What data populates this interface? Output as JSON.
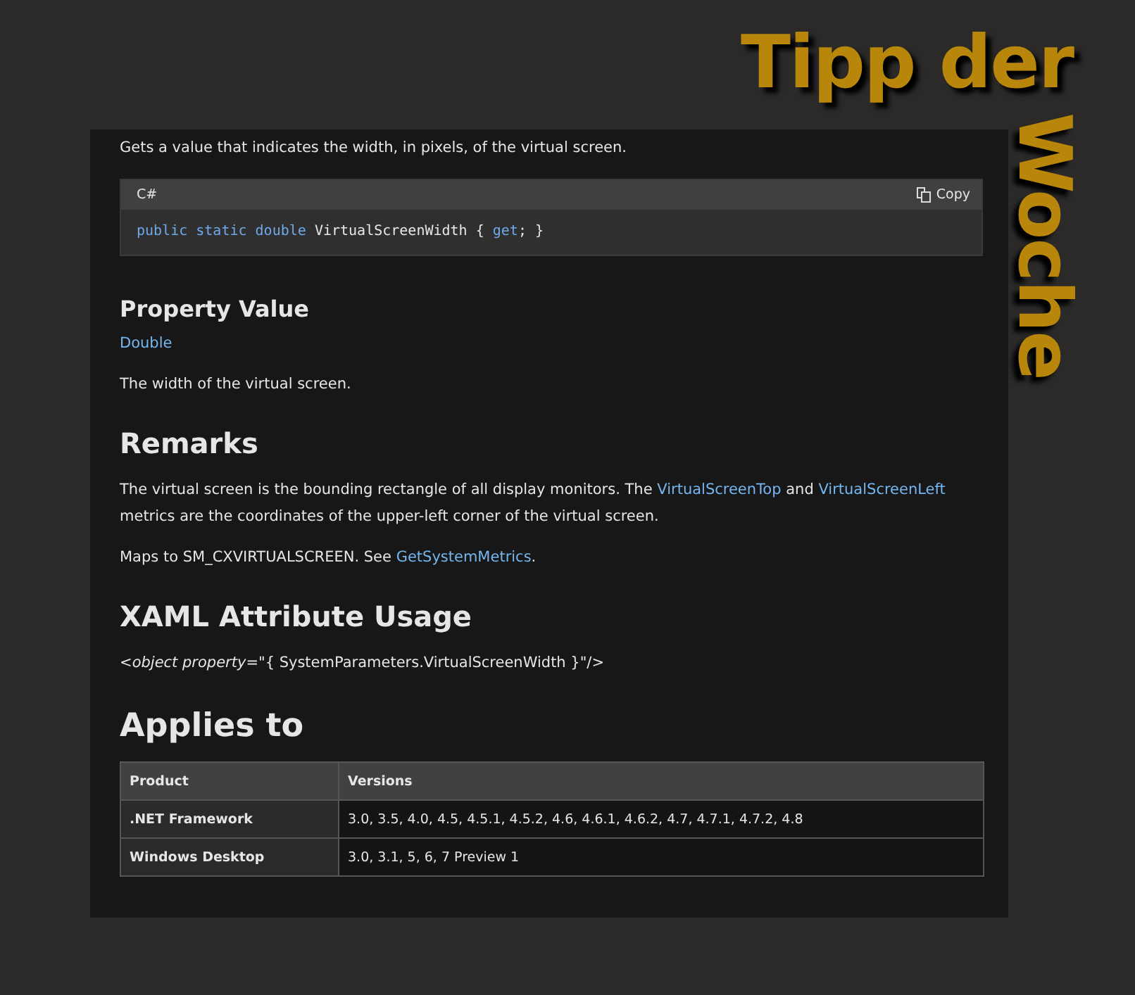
{
  "banner": {
    "title": "Tipp der",
    "vertical_word": "Woche"
  },
  "blocks": [
    {
      "kind": "paragraph",
      "parts": [
        {
          "kind": "text",
          "text": "Gets a value that indicates the width, in pixels, of the virtual screen."
        }
      ]
    },
    {
      "kind": "code",
      "language": "C#",
      "copy_label": "Copy",
      "tokens": [
        {
          "kind": "keyword",
          "text": "public static double"
        },
        {
          "kind": "plain",
          "text": " VirtualScreenWidth { "
        },
        {
          "kind": "keyword",
          "text": "get"
        },
        {
          "kind": "plain",
          "text": "; }"
        }
      ]
    },
    {
      "kind": "subheading",
      "text": "Property Value"
    },
    {
      "kind": "paragraph",
      "parts": [
        {
          "kind": "link",
          "text": "Double"
        }
      ]
    },
    {
      "kind": "paragraph",
      "parts": [
        {
          "kind": "text",
          "text": "The width of the virtual screen."
        }
      ]
    },
    {
      "kind": "section",
      "text": "Remarks"
    },
    {
      "kind": "paragraph",
      "parts": [
        {
          "kind": "text",
          "text": "The virtual screen is the bounding rectangle of all display monitors. The "
        },
        {
          "kind": "link",
          "text": "VirtualScreenTop"
        },
        {
          "kind": "text",
          "text": " and "
        },
        {
          "kind": "link",
          "text": "VirtualScreenLeft"
        },
        {
          "kind": "text",
          "text": " metrics are the coordinates of the upper-left corner of the virtual screen."
        }
      ]
    },
    {
      "kind": "paragraph",
      "parts": [
        {
          "kind": "text",
          "text": "Maps to SM_CXVIRTUALSCREEN. See "
        },
        {
          "kind": "link",
          "text": "GetSystemMetrics"
        },
        {
          "kind": "text",
          "text": "."
        }
      ]
    },
    {
      "kind": "section",
      "text": "XAML Attribute Usage"
    },
    {
      "kind": "markup",
      "text": "<*object property*=\"{ SystemParameters.VirtualScreenWidth }\"/>"
    },
    {
      "kind": "title",
      "text": "Applies to"
    },
    {
      "kind": "table",
      "columns": [
        "Product",
        "Versions"
      ],
      "rows": [
        [
          "3.0, 3.5, 4.0, 4.5, 4.5.1, 4.5.2, 4.6, 4.6.1, 4.6.2, 4.7, 4.7.1, 4.7.2, 4.8"
        ],
        [
          "3.0, 3.1, 5, 6, 7 Preview 1"
        ]
      ],
      "products": [
        ".NET Framework",
        "Windows Desktop"
      ]
    }
  ]
}
